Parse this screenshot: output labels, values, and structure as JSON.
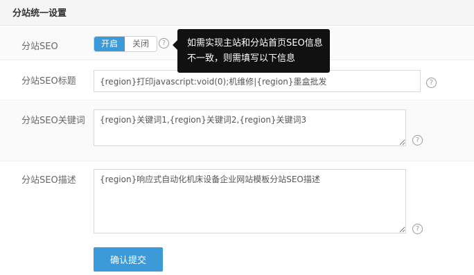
{
  "section": {
    "title": "分站统一设置"
  },
  "seo_toggle": {
    "label": "分站SEO",
    "on_label": "开启",
    "off_label": "关闭",
    "state": "on"
  },
  "tooltip": {
    "line1": "如需实现主站和分站首页SEO信息",
    "line2": "不一致，则需填写以下信息"
  },
  "seo_title": {
    "label": "分站SEO标题",
    "value": "{region}打印javascript:void(0);机维修|{region}墨盒批发"
  },
  "seo_keywords": {
    "label": "分站SEO关键词",
    "value": "{region}关键词1,{region}关键词2,{region}关键词3"
  },
  "seo_description": {
    "label": "分站SEO描述",
    "value": "{region}响应式自动化机床设备企业网站模板分站SEO描述"
  },
  "help_icon": {
    "glyph": "?"
  },
  "submit": {
    "label": "确认提交"
  },
  "colors": {
    "accent": "#3d9ad8",
    "tooltip_bg": "#111111"
  }
}
